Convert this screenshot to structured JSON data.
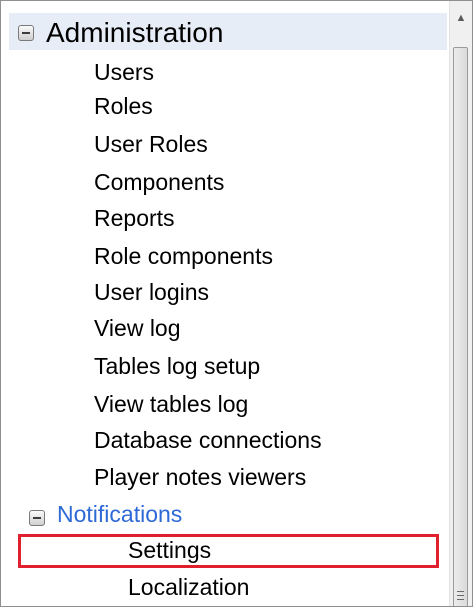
{
  "tree": {
    "root": {
      "label": "Administration",
      "icon": "collapse-icon"
    },
    "items": [
      "Users",
      "Roles",
      "User Roles",
      "Components",
      "Reports",
      "Role components",
      "User logins",
      "View log",
      "Tables log setup",
      "View tables log",
      "Database connections",
      "Player notes viewers"
    ],
    "notifications": {
      "label": "Notifications",
      "icon": "collapse-icon",
      "color": "#2e6ad6",
      "children": [
        "Settings",
        "Localization"
      ],
      "selected": "Settings"
    }
  },
  "colors": {
    "selection_outline": "#e0202c",
    "root_row_background": "#e6edf6"
  },
  "scrollbar": {
    "up_icon": "scroll-up-arrow-icon",
    "grip_icon": "scroll-grip-icon"
  }
}
